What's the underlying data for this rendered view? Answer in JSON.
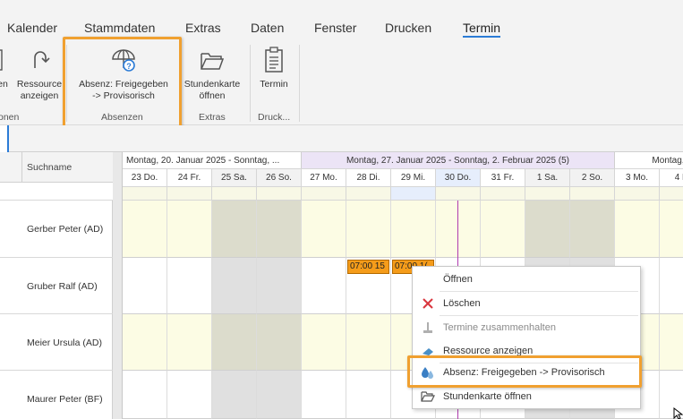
{
  "menu": {
    "items": [
      "Kalender",
      "Stammdaten",
      "Extras",
      "Daten",
      "Fenster",
      "Drucken",
      "Termin"
    ],
    "active": "Termin"
  },
  "ribbon": {
    "partial_button_label": "en",
    "ressource": {
      "label": "Ressource\nanzeigen",
      "line1": "Ressource",
      "line2": "anzeigen"
    },
    "absenz": {
      "line1": "Absenz: Freigegeben",
      "line2": "-> Provisorisch"
    },
    "stundenkarte": {
      "line1": "Stundenkarte",
      "line2": "öffnen"
    },
    "termin": {
      "line1": "Termin"
    },
    "groups": {
      "partial": "onen",
      "absenzen": "Absenzen",
      "extras": "Extras",
      "druck": "Druck..."
    }
  },
  "grid": {
    "column_title": "Suchname",
    "resources": [
      "Gerber Peter (AD)",
      "Gruber Ralf (AD)",
      "Meier Ursula (AD)",
      "Maurer Peter (BF)"
    ],
    "weeks": [
      "Montag, 20. Januar 2025 - Sonntag, ...",
      "Montag, 27. Januar 2025 - Sonntag, 2. Februar 2025 (5)",
      "Montag,"
    ],
    "days": [
      "23 Do.",
      "24 Fr.",
      "25 Sa.",
      "26 So.",
      "27 Mo.",
      "28 Di.",
      "29 Mi.",
      "30 Do.",
      "31 Fr.",
      "1 Sa.",
      "2 So.",
      "3 Mo.",
      "4 D"
    ],
    "appointments": [
      "07:00 15",
      "07:00 1("
    ]
  },
  "context_menu": {
    "items": [
      {
        "label": "Öffnen",
        "enabled": true
      },
      {
        "label": "Löschen",
        "enabled": true
      },
      {
        "label": "Termine zusammenhalten",
        "enabled": false
      },
      {
        "label": "Ressource anzeigen",
        "enabled": true
      },
      {
        "label": "Absenz: Freigegeben -> Provisorisch",
        "enabled": true,
        "highlighted": true
      },
      {
        "label": "Stundenkarte öffnen",
        "enabled": true
      }
    ]
  },
  "colors": {
    "accent": "#2b7bd6",
    "highlight": "#f0a030",
    "appointment": "#f59c1a",
    "weekday_cell": "#fcfce4",
    "weekend_cell": "#e0e0e0",
    "today_line": "#b03cb0",
    "current_week_header": "#ece4f6"
  }
}
